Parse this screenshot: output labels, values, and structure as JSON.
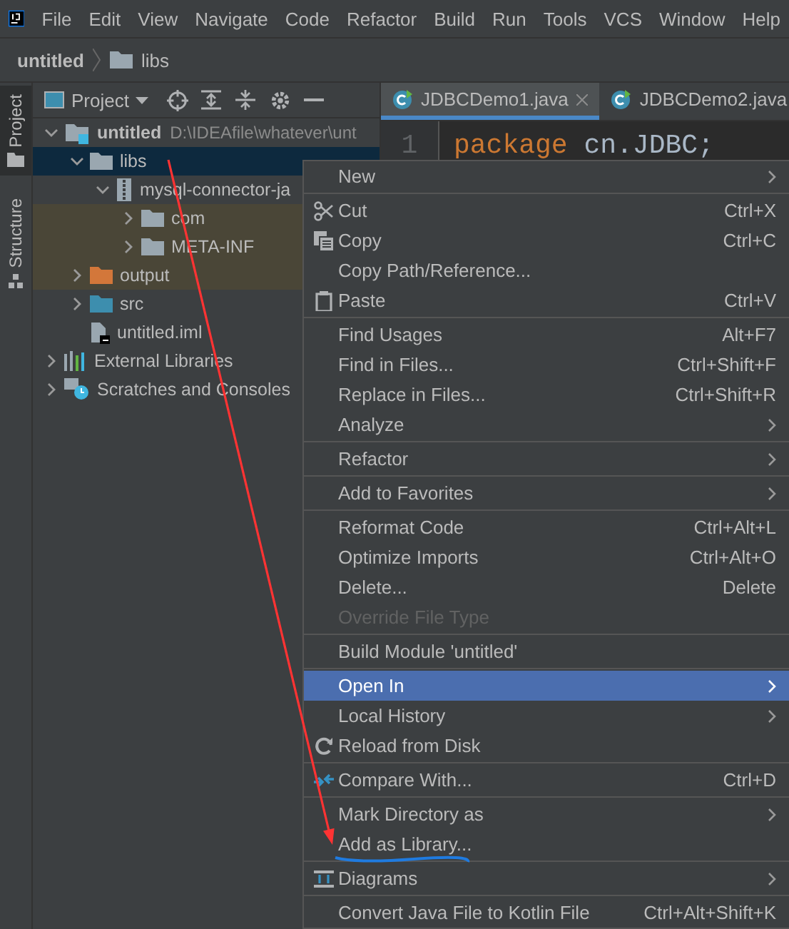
{
  "menubar": [
    "File",
    "Edit",
    "View",
    "Navigate",
    "Code",
    "Refactor",
    "Build",
    "Run",
    "Tools",
    "VCS",
    "Window",
    "Help"
  ],
  "breadcrumb": [
    {
      "label": "untitled",
      "kind": "module"
    },
    {
      "label": "libs",
      "kind": "folder"
    }
  ],
  "side_tabs": [
    {
      "label": "Project",
      "selected": true
    },
    {
      "label": "Structure",
      "selected": false
    }
  ],
  "project_panel": {
    "view": "Project",
    "tree": [
      {
        "label": "untitled",
        "path": "D:\\IDEAfile\\whatever\\unt",
        "kind": "module",
        "expanded": true,
        "selected": false,
        "highlighted": false,
        "children": [
          {
            "label": "libs",
            "kind": "folder",
            "expanded": true,
            "selected": true,
            "highlighted": false,
            "children": [
              {
                "label": "mysql-connector-ja",
                "kind": "jar",
                "expanded": true,
                "selected": false,
                "highlighted": false,
                "children": [
                  {
                    "label": "com",
                    "kind": "folder",
                    "expanded": false,
                    "selected": false,
                    "highlighted": true
                  },
                  {
                    "label": "META-INF",
                    "kind": "folder",
                    "expanded": false,
                    "selected": false,
                    "highlighted": true
                  }
                ]
              }
            ]
          },
          {
            "label": "output",
            "kind": "excluded",
            "expanded": false,
            "selected": false,
            "highlighted": true
          },
          {
            "label": "src",
            "kind": "source",
            "expanded": false,
            "selected": false,
            "highlighted": false
          },
          {
            "label": "untitled.iml",
            "kind": "file",
            "selected": false,
            "highlighted": false
          }
        ]
      },
      {
        "label": "External Libraries",
        "kind": "libraries",
        "expanded": false,
        "selected": false,
        "highlighted": false
      },
      {
        "label": "Scratches and Consoles",
        "kind": "scratches",
        "expanded": false,
        "selected": false,
        "highlighted": false
      }
    ]
  },
  "editor": {
    "tabs": [
      {
        "label": "JDBCDemo1.java",
        "selected": true
      },
      {
        "label": "JDBCDemo2.java",
        "selected": false
      }
    ],
    "lines": [
      {
        "number": "1",
        "tokens": [
          {
            "kind": "keyword",
            "text": "package"
          },
          {
            "kind": "plain",
            "text": " cn.JDBC;"
          }
        ]
      }
    ]
  },
  "context_menu": {
    "sections": [
      [
        {
          "label": "New",
          "submenu": true,
          "disabled": false,
          "selected": false
        }
      ],
      [
        {
          "label": "Cut",
          "shortcut": "Ctrl+X",
          "submenu": false,
          "disabled": false,
          "selected": false
        },
        {
          "label": "Copy",
          "shortcut": "Ctrl+C",
          "submenu": false,
          "disabled": false,
          "selected": false
        },
        {
          "label": "Copy Path/Reference...",
          "submenu": false,
          "disabled": false,
          "selected": false
        },
        {
          "label": "Paste",
          "shortcut": "Ctrl+V",
          "submenu": false,
          "disabled": false,
          "selected": false
        }
      ],
      [
        {
          "label": "Find Usages",
          "shortcut": "Alt+F7",
          "submenu": false,
          "disabled": false,
          "selected": false
        },
        {
          "label": "Find in Files...",
          "shortcut": "Ctrl+Shift+F",
          "submenu": false,
          "disabled": false,
          "selected": false
        },
        {
          "label": "Replace in Files...",
          "shortcut": "Ctrl+Shift+R",
          "submenu": false,
          "disabled": false,
          "selected": false
        },
        {
          "label": "Analyze",
          "submenu": true,
          "disabled": false,
          "selected": false
        }
      ],
      [
        {
          "label": "Refactor",
          "submenu": true,
          "disabled": false,
          "selected": false
        }
      ],
      [
        {
          "label": "Add to Favorites",
          "submenu": true,
          "disabled": false,
          "selected": false
        }
      ],
      [
        {
          "label": "Reformat Code",
          "shortcut": "Ctrl+Alt+L",
          "submenu": false,
          "disabled": false,
          "selected": false
        },
        {
          "label": "Optimize Imports",
          "shortcut": "Ctrl+Alt+O",
          "submenu": false,
          "disabled": false,
          "selected": false
        },
        {
          "label": "Delete...",
          "shortcut": "Delete",
          "submenu": false,
          "disabled": false,
          "selected": false
        },
        {
          "label": "Override File Type",
          "submenu": false,
          "disabled": true,
          "selected": false
        }
      ],
      [
        {
          "label": "Build Module 'untitled'",
          "submenu": false,
          "disabled": false,
          "selected": false
        }
      ],
      [
        {
          "label": "Open In",
          "submenu": true,
          "disabled": false,
          "selected": true
        },
        {
          "label": "Local History",
          "submenu": true,
          "disabled": false,
          "selected": false
        },
        {
          "label": "Reload from Disk",
          "submenu": false,
          "disabled": false,
          "selected": false
        }
      ],
      [
        {
          "label": "Compare With...",
          "shortcut": "Ctrl+D",
          "submenu": false,
          "disabled": false,
          "selected": false
        }
      ],
      [
        {
          "label": "Mark Directory as",
          "submenu": true,
          "disabled": false,
          "selected": false
        },
        {
          "label": "Add as Library...",
          "submenu": false,
          "disabled": false,
          "selected": false
        }
      ],
      [
        {
          "label": "Diagrams",
          "submenu": true,
          "disabled": false,
          "selected": false
        }
      ],
      [
        {
          "label": "Convert Java File to Kotlin File",
          "shortcut": "Ctrl+Alt+Shift+K",
          "submenu": false,
          "disabled": false,
          "selected": false
        }
      ]
    ]
  }
}
